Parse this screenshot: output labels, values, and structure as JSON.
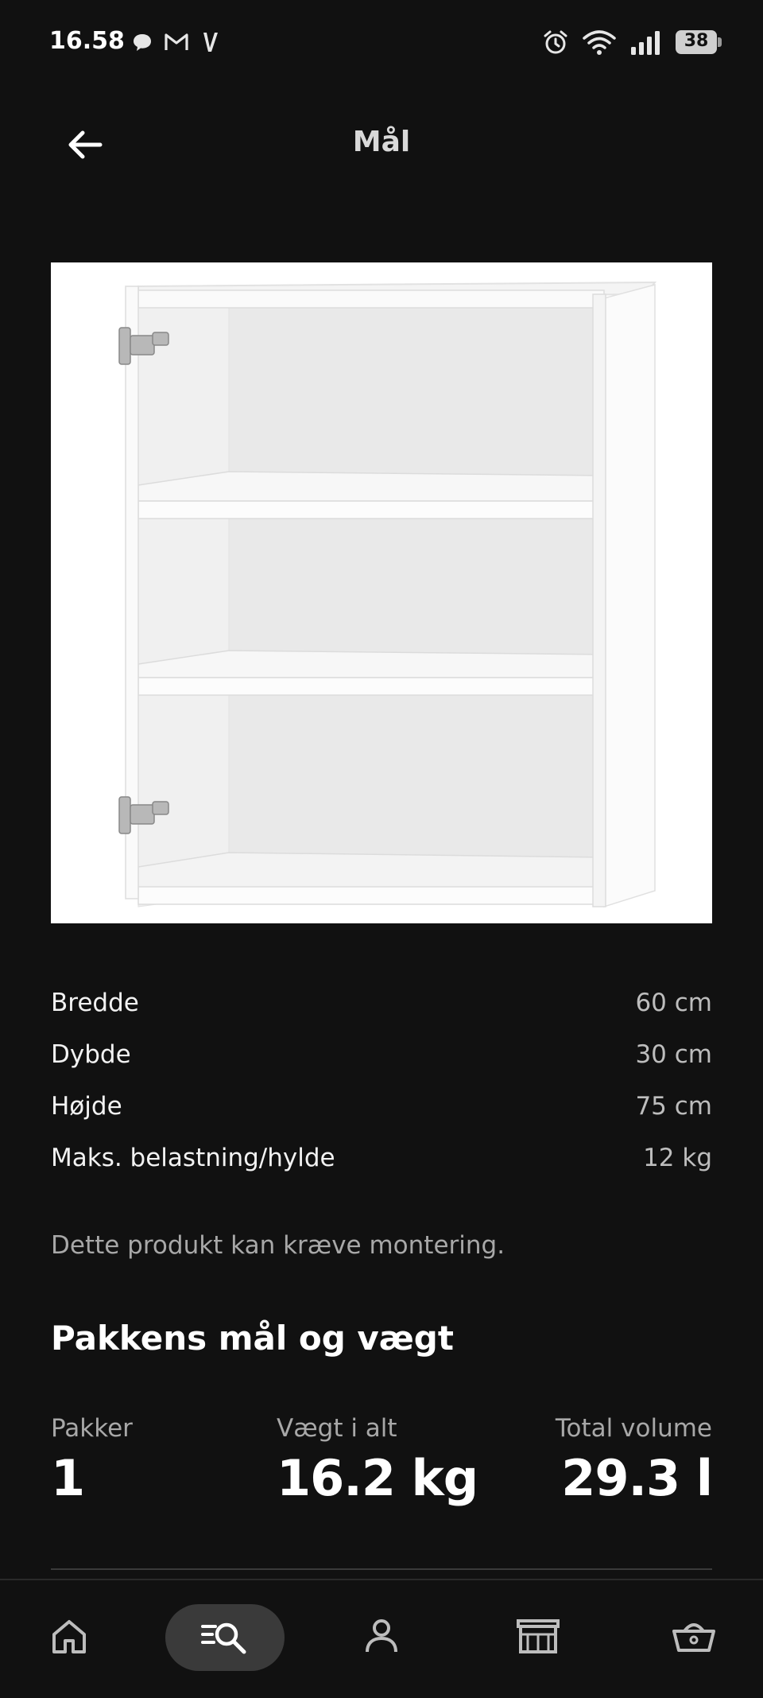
{
  "status_bar": {
    "time": "16.58",
    "battery": "38",
    "left_icons": [
      "chat-bubble-icon",
      "gmail-icon",
      "v-app-icon"
    ],
    "right_icons": [
      "alarm-icon",
      "wifi-icon",
      "signal-icon",
      "battery-icon"
    ]
  },
  "header": {
    "title": "Mål",
    "back_icon": "back-arrow-icon"
  },
  "dimensions": [
    {
      "label": "Bredde",
      "value": "60 cm"
    },
    {
      "label": "Dybde",
      "value": "30 cm"
    },
    {
      "label": "Højde",
      "value": "75 cm"
    },
    {
      "label": "Maks. belastning/hylde",
      "value": "12 kg"
    }
  ],
  "assembly_note": "Dette produkt kan kræve montering.",
  "package": {
    "title": "Pakkens mål og vægt",
    "packages_label": "Pakker",
    "packages_value": "1",
    "weight_label": "Vægt i alt",
    "weight_value": "16.2 kg",
    "volume_label": "Total volume",
    "volume_value": "29.3 l"
  },
  "bottom_nav": {
    "items": [
      "home-icon",
      "search-icon",
      "profile-icon",
      "store-icon",
      "basket-icon"
    ],
    "active": "search-icon"
  },
  "colors": {
    "background": "#111111",
    "text": "#ffffff",
    "muted": "#a8a8a8",
    "active_pill": "#3a3a3a"
  }
}
